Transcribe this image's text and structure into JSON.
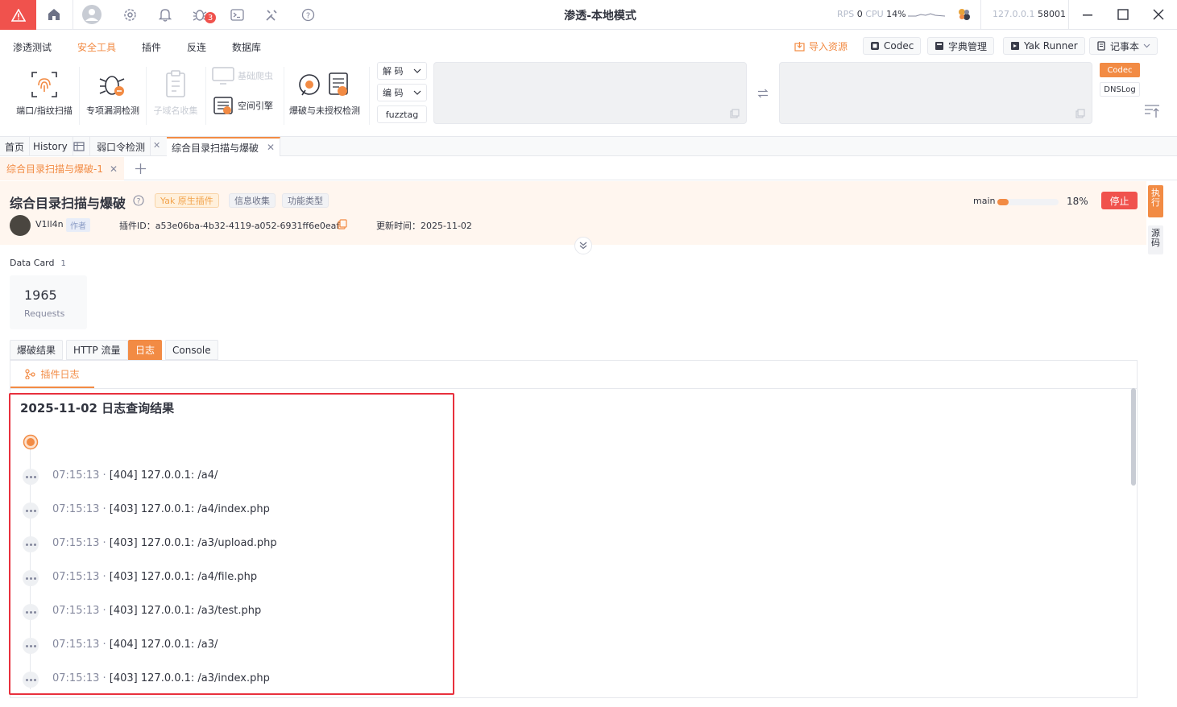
{
  "titlebar": {
    "title": "渗透-本地模式",
    "rps_label": "RPS",
    "rps_value": "0",
    "cpu_label": "CPU",
    "cpu_value": "14%",
    "address": "127.0.0.1",
    "port": "58001",
    "bug_count": "3",
    "icons": [
      "warning-icon",
      "home-icon",
      "user-avatar-icon",
      "gear-icon",
      "bell-icon",
      "bug-icon",
      "terminal-icon",
      "tools-icon",
      "help-icon",
      "engine-icon",
      "minimize-icon",
      "maximize-icon",
      "close-icon"
    ]
  },
  "menu": {
    "items": [
      {
        "label": "渗透测试"
      },
      {
        "label": "安全工具"
      },
      {
        "label": "插件"
      },
      {
        "label": "反连"
      },
      {
        "label": "数据库"
      }
    ],
    "active": "安全工具",
    "import_label": "导入资源",
    "codec_label": "Codec",
    "dict_label": "字典管理",
    "runner_label": "Yak Runner",
    "notebook_label": "记事本"
  },
  "ribbon": {
    "items": [
      {
        "label": "端口/指纹扫描"
      },
      {
        "label": "专项漏洞检测"
      },
      {
        "label": "子域名收集"
      },
      {
        "label": "基础爬虫"
      },
      {
        "label": "空间引擎"
      },
      {
        "label": "爆破与未授权检测"
      }
    ],
    "decode_label": "解 码",
    "encode_label": "编 码",
    "fuzztag_label": "fuzztag",
    "codec_tab": "Codec",
    "dnslog_tab": "DNSLog"
  },
  "tabs": {
    "home": "首页",
    "history": "History",
    "weak_pass": "弱口令检测",
    "active_tab": "综合目录扫描与爆破",
    "sub_tab": "综合目录扫描与爆破-1"
  },
  "plugin": {
    "title": "综合目录扫描与爆破",
    "tag_native": "Yak 原生插件",
    "tag_info": "信息收集",
    "tag_type": "功能类型",
    "author": "V1ll4n",
    "author_role": "作者",
    "plugin_id": "插件ID：a53e06ba-4b32-4119-a052-6931ff6e0eaf",
    "updated": "更新时间：2025-11-02",
    "progress_label": "main",
    "progress_percent": "18%",
    "progress_fraction": 0.18,
    "stop_label": "停止",
    "exec_tab": "执行",
    "source_tab": "源码"
  },
  "datacard": {
    "label": "Data Card",
    "count": "1",
    "value": "1965",
    "caption": "Requests"
  },
  "result_tabs": [
    {
      "label": "爆破结果"
    },
    {
      "label": "HTTP 流量"
    },
    {
      "label": "日志"
    },
    {
      "label": "Console"
    }
  ],
  "log": {
    "plugin_log_tab": "插件日志",
    "title": "2025-11-02 日志查询结果",
    "entries": [
      {
        "time": "07:15:13",
        "text": "[404] 127.0.0.1: /a4/"
      },
      {
        "time": "07:15:13",
        "text": "[403] 127.0.0.1: /a4/index.php"
      },
      {
        "time": "07:15:13",
        "text": "[403] 127.0.0.1: /a3/upload.php"
      },
      {
        "time": "07:15:13",
        "text": "[403] 127.0.0.1: /a4/file.php"
      },
      {
        "time": "07:15:13",
        "text": "[403] 127.0.0.1: /a3/test.php"
      },
      {
        "time": "07:15:13",
        "text": "[404] 127.0.0.1: /a3/"
      },
      {
        "time": "07:15:13",
        "text": "[403] 127.0.0.1: /a3/index.php"
      }
    ]
  },
  "colors": {
    "accent": "#f28b44",
    "danger": "#f0524d",
    "highlight": "#e8303d"
  }
}
